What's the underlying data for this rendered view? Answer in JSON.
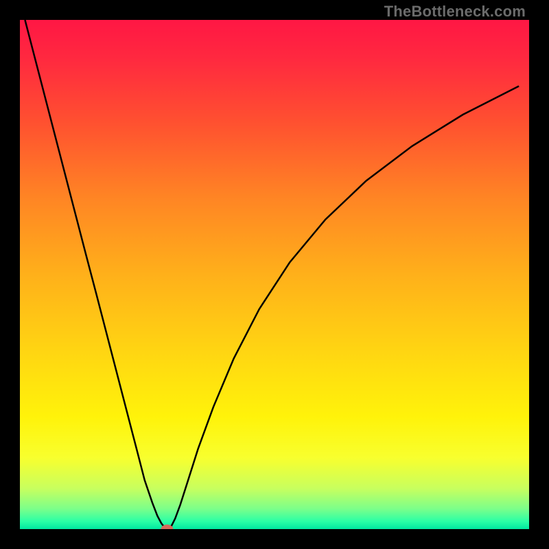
{
  "watermark": "TheBottleneck.com",
  "chart_data": {
    "type": "line",
    "title": "",
    "xlabel": "",
    "ylabel": "",
    "xlim": [
      0,
      100
    ],
    "ylim": [
      0,
      100
    ],
    "grid": false,
    "legend": false,
    "background": {
      "type": "gradient-vertical",
      "stops": [
        {
          "pos": 0.0,
          "color": "#ff1744"
        },
        {
          "pos": 0.08,
          "color": "#ff2a3f"
        },
        {
          "pos": 0.2,
          "color": "#ff5030"
        },
        {
          "pos": 0.35,
          "color": "#ff8524"
        },
        {
          "pos": 0.5,
          "color": "#ffb01a"
        },
        {
          "pos": 0.65,
          "color": "#ffd512"
        },
        {
          "pos": 0.78,
          "color": "#fff30a"
        },
        {
          "pos": 0.86,
          "color": "#f8ff2e"
        },
        {
          "pos": 0.92,
          "color": "#c8ff5e"
        },
        {
          "pos": 0.96,
          "color": "#7cff8a"
        },
        {
          "pos": 0.985,
          "color": "#2affa6"
        },
        {
          "pos": 1.0,
          "color": "#00e8a0"
        }
      ]
    },
    "series": [
      {
        "name": "curve",
        "color": "#000000",
        "stroke_width": 2.5,
        "x": [
          1,
          3,
          5,
          7,
          9,
          11,
          13,
          15,
          17,
          19,
          21,
          23,
          24.5,
          26,
          27,
          27.8,
          28.4,
          28.7,
          29,
          29.3,
          29.8,
          30.5,
          31.5,
          33,
          35,
          38,
          42,
          47,
          53,
          60,
          68,
          77,
          87,
          98
        ],
        "y": [
          100,
          92.3,
          84.6,
          76.9,
          69.2,
          61.5,
          53.8,
          46.2,
          38.5,
          30.8,
          23.1,
          15.4,
          9.6,
          5.2,
          2.6,
          1.1,
          0.35,
          0.08,
          0.0,
          0.12,
          0.7,
          2.1,
          4.8,
          9.5,
          15.8,
          24.0,
          33.5,
          43.2,
          52.4,
          60.8,
          68.4,
          75.2,
          81.4,
          87.0
        ]
      }
    ],
    "marker": {
      "name": "minimum-point",
      "x": 28.9,
      "y": 0.0,
      "rx": 1.2,
      "ry": 0.9,
      "color": "#d46a5a"
    }
  }
}
